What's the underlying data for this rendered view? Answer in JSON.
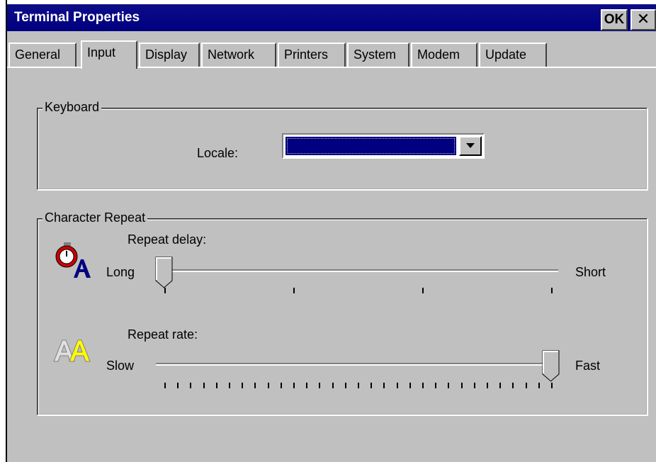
{
  "window": {
    "title": "Terminal Properties",
    "ok_label": "OK",
    "close_glyph": "✕"
  },
  "tabs": [
    {
      "label": "General",
      "active": false
    },
    {
      "label": "Input",
      "active": true
    },
    {
      "label": "Display",
      "active": false
    },
    {
      "label": "Network",
      "active": false
    },
    {
      "label": "Printers",
      "active": false
    },
    {
      "label": "System",
      "active": false
    },
    {
      "label": "Modem",
      "active": false
    },
    {
      "label": "Update",
      "active": false
    }
  ],
  "keyboard": {
    "legend": "Keyboard",
    "locale_label": "Locale:",
    "locale_value": ""
  },
  "character_repeat": {
    "legend": "Character Repeat",
    "delay": {
      "label": "Repeat delay:",
      "min_label": "Long",
      "max_label": "Short",
      "tick_count": 4,
      "position": 0.0
    },
    "rate": {
      "label": "Repeat rate:",
      "min_label": "Slow",
      "max_label": "Fast",
      "tick_count": 31,
      "position": 1.0
    }
  },
  "icons": {
    "delay_icon": "stopwatch-letter-icon",
    "rate_icon": "double-letter-icon"
  },
  "colors": {
    "titlebar": "#000080",
    "face": "#c0c0c0",
    "selection": "#000080"
  }
}
